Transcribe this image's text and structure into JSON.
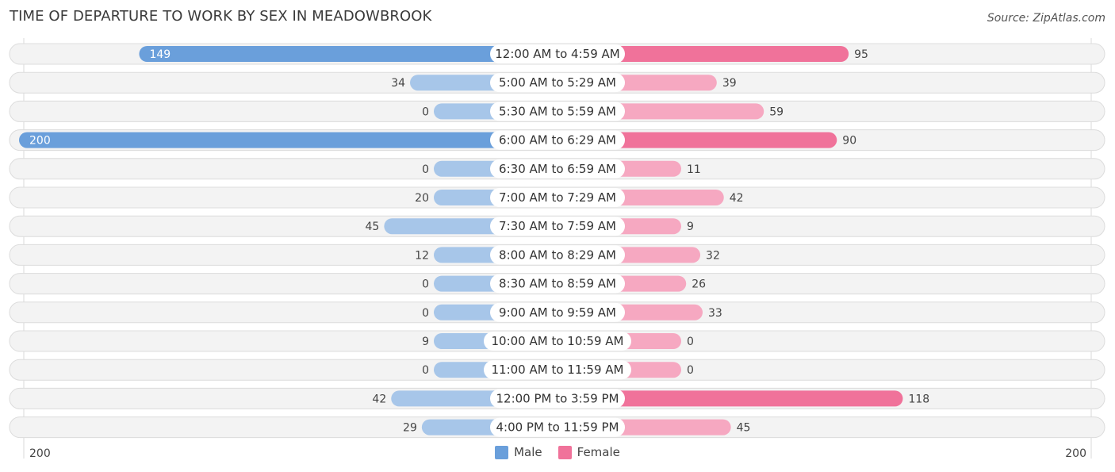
{
  "header": {
    "title": "TIME OF DEPARTURE TO WORK BY SEX IN MEADOWBROOK",
    "source": "Source: ZipAtlas.com"
  },
  "colors": {
    "male": "#6a9fdb",
    "male_light": "#a7c6e9",
    "female": "#f0729a",
    "female_light": "#f6a8c1"
  },
  "legend": [
    {
      "label": "Male",
      "color": "#6a9fdb"
    },
    {
      "label": "Female",
      "color": "#f0729a"
    }
  ],
  "chart_data": {
    "type": "bar",
    "orientation": "horizontal-diverging",
    "title": "TIME OF DEPARTURE TO WORK BY SEX IN MEADOWBROOK",
    "categories": [
      "12:00 AM to 4:59 AM",
      "5:00 AM to 5:29 AM",
      "5:30 AM to 5:59 AM",
      "6:00 AM to 6:29 AM",
      "6:30 AM to 6:59 AM",
      "7:00 AM to 7:29 AM",
      "7:30 AM to 7:59 AM",
      "8:00 AM to 8:29 AM",
      "8:30 AM to 8:59 AM",
      "9:00 AM to 9:59 AM",
      "10:00 AM to 10:59 AM",
      "11:00 AM to 11:59 AM",
      "12:00 PM to 3:59 PM",
      "4:00 PM to 11:59 PM"
    ],
    "series": [
      {
        "name": "Male",
        "values": [
          149,
          34,
          0,
          200,
          0,
          20,
          45,
          12,
          0,
          0,
          9,
          0,
          42,
          29
        ]
      },
      {
        "name": "Female",
        "values": [
          95,
          39,
          59,
          90,
          11,
          42,
          9,
          32,
          26,
          33,
          0,
          0,
          118,
          45
        ]
      }
    ],
    "axis": {
      "left_label": "200",
      "right_label": "200",
      "max": 200
    },
    "legend_position": "bottom-center",
    "grid": false
  }
}
